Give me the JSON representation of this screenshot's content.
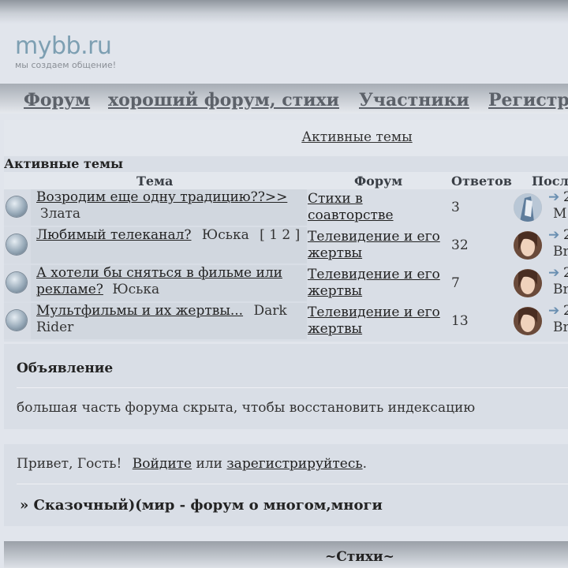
{
  "logo": {
    "text": "mybb.ru",
    "tagline": "мы создаем общение!"
  },
  "nav": {
    "items": [
      "Форум",
      "хороший форум, стихи",
      "Участники",
      "Регистр"
    ]
  },
  "active": {
    "title_link": "Активные темы",
    "subtitle": "Активные темы",
    "columns": {
      "topic": "Тема",
      "forum": "Форум",
      "replies": "Ответов",
      "last": "Посл"
    },
    "rows": [
      {
        "topic": "Возродим еще одну традицию??>>",
        "author": "Злата",
        "pages": "",
        "forum": "Стихи в соавторстве",
        "replies": "3",
        "last_digit": "2",
        "last_user": "M"
      },
      {
        "topic": "Любимый телеканал?",
        "author": "Юська",
        "pages": "[ 1 2 ]",
        "forum": "Телевидение и его жертвы",
        "replies": "32",
        "last_digit": "2",
        "last_user": "Br"
      },
      {
        "topic": "А хотели бы сняться в фильме или рекламе?",
        "author": "Юська",
        "pages": "",
        "forum": "Телевидение и его жертвы",
        "replies": "7",
        "last_digit": "2",
        "last_user": "Br"
      },
      {
        "topic": "Мультфильмы и их жертвы...",
        "author": "Dark Rider",
        "pages": "",
        "forum": "Телевидение и его жертвы",
        "replies": "13",
        "last_digit": "2",
        "last_user": "Br"
      }
    ]
  },
  "announcement": {
    "title": "Объявление",
    "text": "большая часть форума скрыта, чтобы восстановить индексацию"
  },
  "welcome": {
    "greeting": "Привет, Гость!",
    "login": "Войдите",
    "or": "или",
    "register": "зарегистрируйтесь",
    "dot": ".",
    "board_title": "» Сказочный)(мир - форум о многом,многи"
  },
  "section": {
    "title": "~Стихи~"
  },
  "colors": {
    "accent": "#7d9fb2",
    "arrow": "#6a8fb1"
  }
}
